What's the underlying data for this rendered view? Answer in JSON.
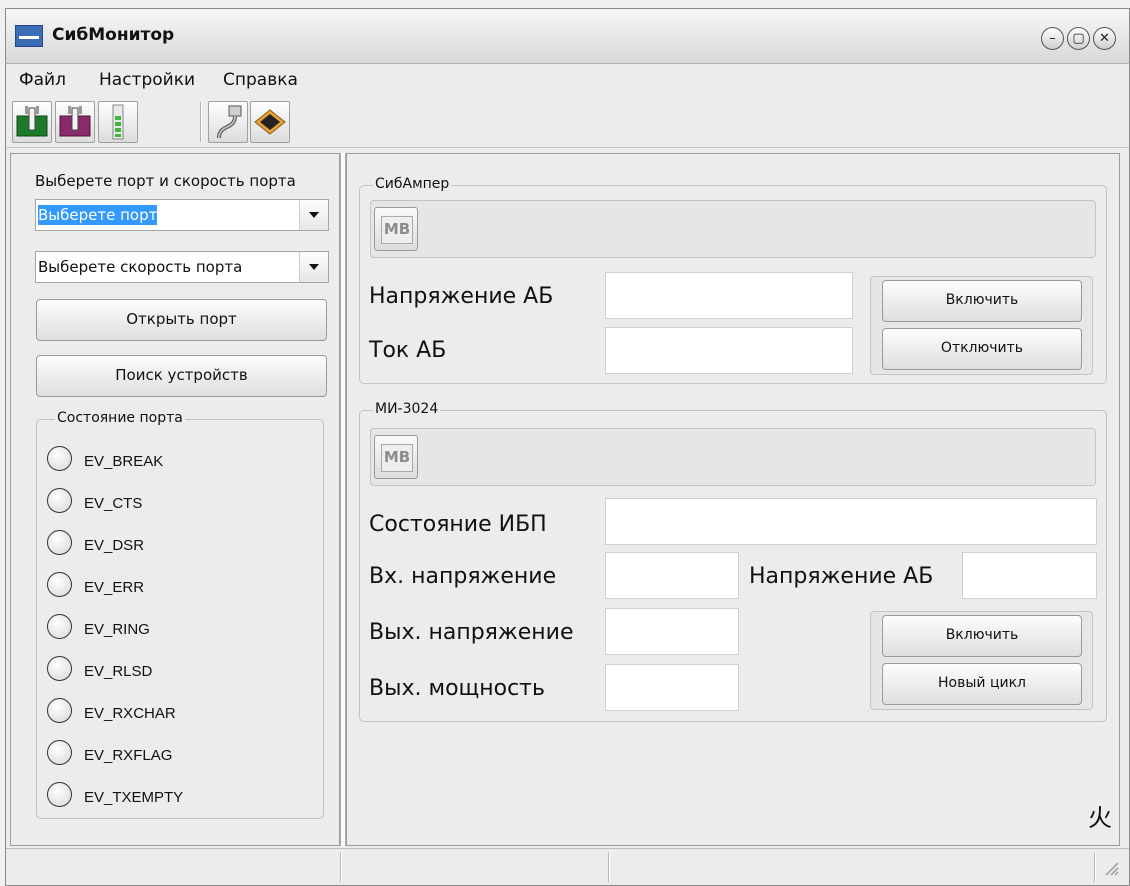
{
  "window": {
    "title": "СибМонитор",
    "controls": [
      "–",
      "▢",
      "✕"
    ]
  },
  "menu": [
    "Файл",
    "Настройки",
    "Справка"
  ],
  "toolbar": {
    "icons": [
      "plug-green-icon",
      "plug-purple-icon",
      "battery-icon",
      "serial-cable-icon",
      "chip-icon"
    ]
  },
  "left": {
    "heading": "Выберете порт и скорость порта",
    "port_combo": "Выберете порт",
    "speed_combo": "Выберете скорость порта",
    "open_port": "Открыть порт",
    "search": "Поиск устройств",
    "state_group": "Состояние порта",
    "events": [
      "EV_BREAK",
      "EV_CTS",
      "EV_DSR",
      "EV_ERR",
      "EV_RING",
      "EV_RLSD",
      "EV_RXCHAR",
      "EV_RXFLAG",
      "EV_TXEMPTY"
    ]
  },
  "sibamper": {
    "group": "СибАмпер",
    "mb": "MB",
    "voltage_label": "Напряжение АБ",
    "current_label": "Ток АБ",
    "voltage_value": "",
    "current_value": "",
    "on": "Включить",
    "off": "Отключить"
  },
  "mi3024": {
    "group": "МИ-3024",
    "mb": "MB",
    "ups_state_label": "Состояние ИБП",
    "in_voltage_label": "Вх. напряжение",
    "battery_voltage_label": "Напряжение АБ",
    "out_voltage_label": "Вых. напряжение",
    "out_power_label": "Вых. мощность",
    "ups_state_value": "",
    "in_voltage_value": "",
    "battery_voltage_value": "",
    "out_voltage_value": "",
    "out_power_value": "",
    "on": "Включить",
    "new_cycle": "Новый цикл"
  },
  "corner_glyph": "⽕"
}
